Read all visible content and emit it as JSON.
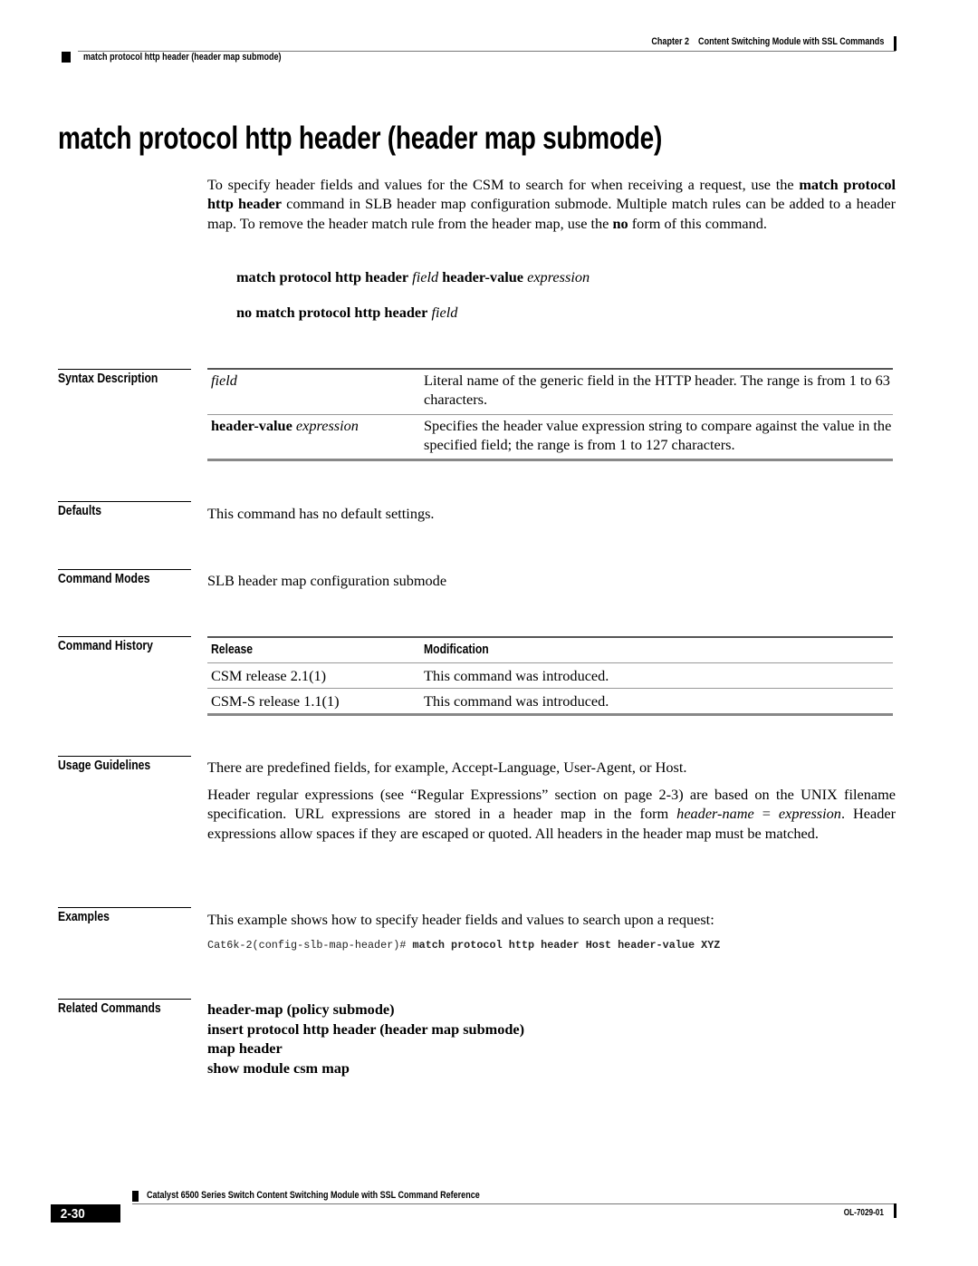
{
  "header": {
    "chapter_label": "Chapter 2",
    "chapter_title": "Content Switching Module with SSL Commands",
    "running_head": "match protocol http header (header map submode)"
  },
  "title": "match protocol http header (header map submode)",
  "intro": {
    "t1": "To specify header fields and values for the CSM to search for when receiving a request, use the ",
    "b1": "match protocol http header",
    "t2": " command in SLB header map configuration submode. Multiple match rules can be added to a header map. To remove the header match rule from the header map, use the ",
    "b2": "no",
    "t3": " form of this command."
  },
  "syntax": {
    "line1": {
      "b1": "match protocol http header",
      "i1": "field",
      "b2": "header-value",
      "i2": "expression"
    },
    "line2": {
      "b1": "no match protocol http header",
      "i1": "field"
    }
  },
  "sections": {
    "syntax_description": "Syntax Description",
    "defaults": "Defaults",
    "command_modes": "Command Modes",
    "command_history": "Command History",
    "usage_guidelines": "Usage Guidelines",
    "examples": "Examples",
    "related_commands": "Related Commands"
  },
  "syntax_table": [
    {
      "arg_bold": "",
      "arg_italic": "field",
      "desc": "Literal name of the generic field in the HTTP header. The range is from 1 to 63 characters."
    },
    {
      "arg_bold": "header-value",
      "arg_italic": "expression",
      "desc": "Specifies the header value expression string to compare against the value in the specified field; the range is from 1 to 127 characters."
    }
  ],
  "defaults_text": "This command has no default settings.",
  "command_modes_text": "SLB header map configuration submode",
  "history": {
    "headers": [
      "Release",
      "Modification"
    ],
    "rows": [
      [
        "CSM release 2.1(1)",
        "This command was introduced."
      ],
      [
        "CSM-S release 1.1(1)",
        "This command was introduced."
      ]
    ]
  },
  "usage": {
    "p1": "There are predefined fields, for example, Accept-Language, User-Agent, or Host.",
    "p2_t1": "Header regular expressions (see “Regular Expressions” section on page 2-3) are based on the UNIX filename specification. URL expressions are stored in a header map in the form ",
    "p2_i1": "header-name",
    "p2_t2": " = ",
    "p2_i2": "expression",
    "p2_t3": ". Header expressions allow spaces if they are escaped or quoted. All headers in the header map must be matched."
  },
  "examples": {
    "intro": "This example shows how to specify header fields and values to search upon a request:",
    "prompt": "Cat6k-2(config-slb-map-header)# ",
    "command": "match protocol http header Host header-value XYZ"
  },
  "related_commands": [
    "header-map (policy submode)",
    "insert protocol http header (header map submode)",
    "map header",
    "show module csm map"
  ],
  "footer": {
    "book_title": "Catalyst 6500 Series Switch Content Switching Module with SSL Command Reference",
    "page_number": "2-30",
    "doc_number": "OL-7029-01"
  }
}
